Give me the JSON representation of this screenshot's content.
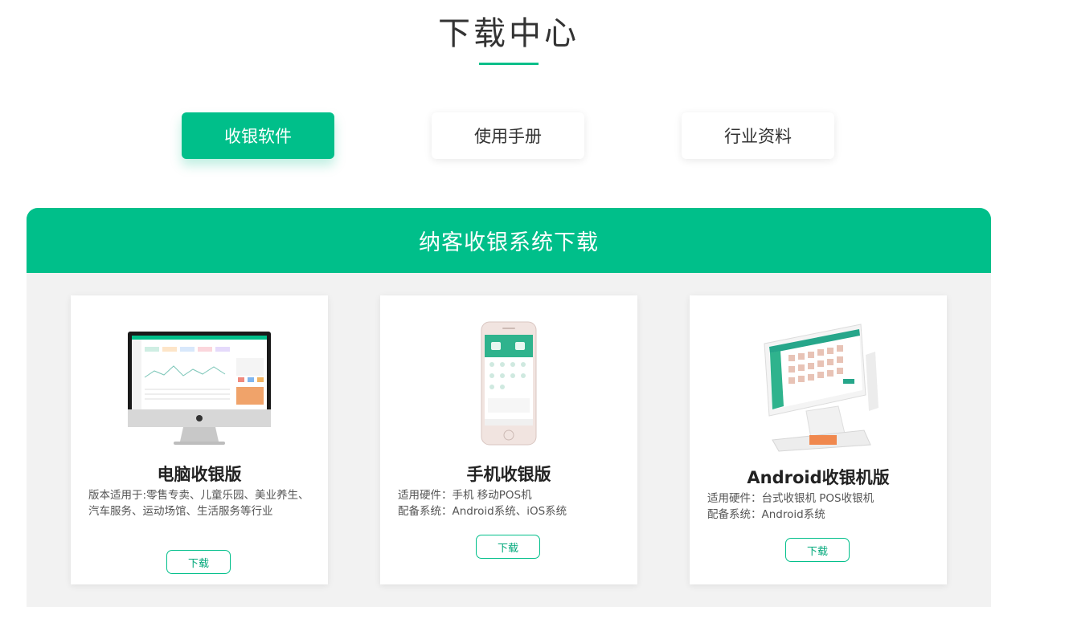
{
  "header": {
    "title": "下载中心"
  },
  "tabs": [
    {
      "label": "收银软件",
      "active": true
    },
    {
      "label": "使用手册",
      "active": false
    },
    {
      "label": "行业资料",
      "active": false
    }
  ],
  "panel": {
    "title": "纳客收银系统下载"
  },
  "cards": [
    {
      "title": "电脑收银版",
      "desc": "版本适用于:零售专卖、儿童乐园、美业养生、汽车服务、运动场馆、生活服务等行业",
      "button": "下载"
    },
    {
      "title": "手机收银版",
      "desc_lines": [
        "适用硬件：手机 移动POS机",
        "配备系统：Android系统、iOS系统"
      ],
      "button": "下载"
    },
    {
      "title": "Android收银机版",
      "desc_lines": [
        "适用硬件：台式收银机 POS收银机",
        "配备系统：Android系统"
      ],
      "button": "下载"
    }
  ],
  "colors": {
    "accent": "#00bf8a",
    "panel_bg": "#f2f2f2"
  }
}
